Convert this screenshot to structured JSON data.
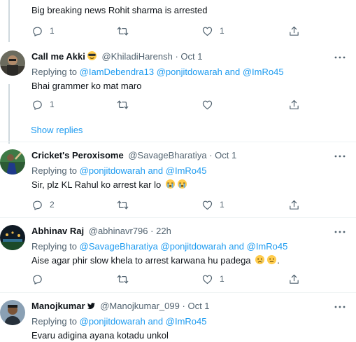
{
  "tweets": [
    {
      "id": "t0",
      "text": "Big breaking news Rohit sharma is arrested",
      "replies": "1",
      "retweets": "",
      "likes": "1"
    },
    {
      "id": "t1",
      "name": "Call me Akki",
      "handle": "@KhiladiHarensh",
      "dot": "·",
      "time": "Oct 1",
      "replying_prefix": "Replying to",
      "replying_to": [
        "@IamDebendra13",
        "@ponjitdowarah",
        "and",
        "@ImRo45"
      ],
      "text": "Bhai grammer ko mat maro",
      "replies": "1",
      "retweets": "",
      "likes": ""
    },
    {
      "id": "t2",
      "name": "Cricket's Peroxisome",
      "handle": "@SavageBharatiya",
      "dot": "·",
      "time": "Oct 1",
      "replying_prefix": "Replying to",
      "replying_to": [
        "@ponjitdowarah",
        "and",
        "@ImRo45"
      ],
      "text": "Sir, plz KL Rahul ko arrest kar lo",
      "replies": "2",
      "retweets": "",
      "likes": "1"
    },
    {
      "id": "t3",
      "name": "Abhinav Raj",
      "handle": "@abhinavr796",
      "dot": "·",
      "time": "22h",
      "replying_prefix": "Replying to",
      "replying_to": [
        "@SavageBharatiya",
        "@ponjitdowarah",
        "and",
        "@ImRo45"
      ],
      "text": "Aise agar phir slow khela to arrest karwana hu padega",
      "text_suffix": ".",
      "replies": "",
      "retweets": "",
      "likes": "1"
    },
    {
      "id": "t4",
      "name": "Manojkumar",
      "handle": "@Manojkumar_099",
      "dot": "·",
      "time": "Oct 1",
      "replying_prefix": "Replying to",
      "replying_to": [
        "@ponjitdowarah",
        "and",
        "@ImRo45"
      ],
      "text": "Evaru adigina ayana kotadu unkol"
    }
  ],
  "show_replies_label": "Show replies",
  "icons": {
    "reply": "reply-icon",
    "retweet": "retweet-icon",
    "like": "heart-icon",
    "share": "share-icon",
    "more": "more-icon"
  },
  "colors": {
    "link": "#1d9bf0",
    "secondary_text": "#536471",
    "divider": "#eff3f4",
    "thread_line": "#cfd9de"
  }
}
